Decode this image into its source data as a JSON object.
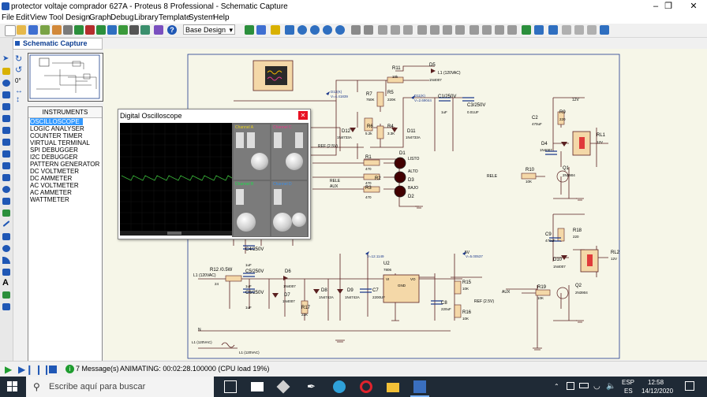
{
  "window": {
    "title": "protector voltaje comprador 627A - Proteus 8 Professional - Schematic Capture",
    "minimize_icon": "minimize-icon",
    "maximize_icon": "restore-icon",
    "close_icon": "close-icon"
  },
  "menu": [
    "File",
    "Edit",
    "View",
    "Tool",
    "Design",
    "Graph",
    "Debug",
    "Library",
    "Template",
    "System",
    "Help"
  ],
  "toolbar": {
    "design_select": "Base Design"
  },
  "tab": {
    "label": "Schematic Capture"
  },
  "rotation_value": "0°",
  "instruments": {
    "header": "INSTRUMENTS",
    "items": [
      "OSCILLOSCOPE",
      "LOGIC ANALYSER",
      "COUNTER TIMER",
      "VIRTUAL TERMINAL",
      "SPI DEBUGGER",
      "I2C DEBUGGER",
      "PATTERN GENERATOR",
      "DC VOLTMETER",
      "DC AMMETER",
      "AC VOLTMETER",
      "AC AMMETER",
      "WATTMETER"
    ],
    "selected": "OSCILLOSCOPE"
  },
  "oscilloscope": {
    "title": "Digital Oscilloscope",
    "channels": [
      "Channel A",
      "Channel B",
      "Channel C",
      "Channel D"
    ],
    "channel_colors": [
      "#e8d21f",
      "#1fd94c",
      "#e63b8a",
      "#3a8de6"
    ],
    "trace_color": "#3cbf3c"
  },
  "schematic": {
    "labels": [
      {
        "text": "R11",
        "t": "10k"
      },
      {
        "text": "D5",
        "t": "1N4007"
      },
      {
        "text": "R5",
        "t": "220K"
      },
      {
        "text": "R7",
        "t": "750K"
      },
      {
        "text": "C1/250V",
        "t": "1uF"
      },
      {
        "text": "C3/250V",
        "t": "0.01UF"
      },
      {
        "text": "D12",
        "t": "1N4733A"
      },
      {
        "text": "R6",
        "t": "5.2k"
      },
      {
        "text": "R4",
        "t": "3.3K"
      },
      {
        "text": "D11",
        "t": "1N4733A"
      },
      {
        "text": "R1",
        "t": "470"
      },
      {
        "text": "R2",
        "t": "470"
      },
      {
        "text": "R3",
        "t": "470"
      },
      {
        "text": "D1",
        "t": "LISTO"
      },
      {
        "text": "D3",
        "t": "ALTO"
      },
      {
        "text": "D2",
        "t": "BAJO"
      },
      {
        "text": "R9",
        "t": "220"
      },
      {
        "text": "C2",
        "t": "470uF"
      },
      {
        "text": "D4",
        "t": "1N4007"
      },
      {
        "text": "RL1",
        "t": "12V"
      },
      {
        "text": "R10",
        "t": "10K"
      },
      {
        "text": "Q1",
        "t": "2N3904"
      },
      {
        "text": "R18",
        "t": "220"
      },
      {
        "text": "C9",
        "t": "470uF"
      },
      {
        "text": "D10",
        "t": "1N4007"
      },
      {
        "text": "RL2",
        "t": "12V"
      },
      {
        "text": "R19",
        "t": "10K"
      },
      {
        "text": "Q2",
        "t": "2N3904"
      },
      {
        "text": "R12 /0.5W",
        "t": "24"
      },
      {
        "text": "C4/250V",
        "t": "1uF"
      },
      {
        "text": "C5/250V",
        "t": "1uF"
      },
      {
        "text": "C6/250V",
        "t": "1uF"
      },
      {
        "text": "D6",
        "t": "1N4007"
      },
      {
        "text": "D7",
        "t": "1N4007"
      },
      {
        "text": "R17",
        "t": "22K"
      },
      {
        "text": "D8",
        "t": "1N4742A"
      },
      {
        "text": "D9",
        "t": "1N4742A"
      },
      {
        "text": "C7",
        "t": "2200UF"
      },
      {
        "text": "U2",
        "t": "7806"
      },
      {
        "text": "C8",
        "t": "220uF"
      },
      {
        "text": "R15",
        "t": "10K"
      },
      {
        "text": "R16",
        "t": "10K"
      }
    ],
    "nets": [
      "L1 (120VAC)",
      "REF (2.5V)",
      "RELE",
      "AUX",
      "12V",
      "L1 (120VAC)",
      "N",
      "5V",
      "REF (2.5V)",
      "AUX",
      "RELE"
    ],
    "probes": [
      "V=4.41839",
      "V=2.69044",
      "V=12.1149",
      "V=5.00537"
    ],
    "misc": [
      "D12(K)",
      "D11(K)",
      "VI",
      "VO",
      "GND",
      "L1 (120VAC)",
      "L1 (120VAC)",
      "RL1",
      "RL2"
    ]
  },
  "status": {
    "messages": "7 Message(s)",
    "animating": "ANIMATING: 00:02:28.100000 (CPU load 19%)"
  },
  "taskbar": {
    "search_placeholder": "Escribe aquí para buscar",
    "lang": "ESP",
    "lang2": "ES",
    "time": "12:58",
    "date": "14/12/2020"
  }
}
